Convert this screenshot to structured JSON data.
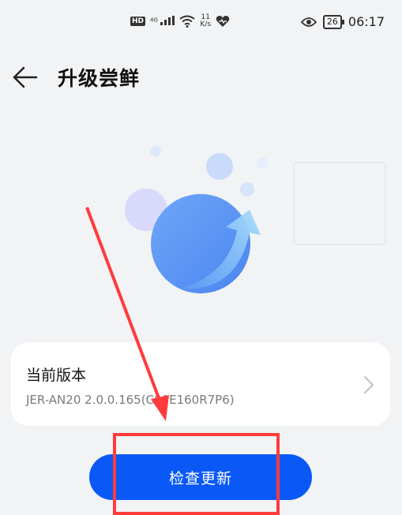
{
  "status_bar": {
    "hd": "HD",
    "network": "4G",
    "speed_value": "11",
    "speed_unit": "K/s",
    "battery": "26",
    "time": "06:17"
  },
  "header": {
    "title": "升级尝鲜",
    "back_icon": "arrow-left-icon"
  },
  "version": {
    "title": "当前版本",
    "value": "JER-AN20 2.0.0.165(C00E160R7P6)"
  },
  "check_button": {
    "label": "检查更新"
  },
  "colors": {
    "accent": "#0a59f7",
    "annotation": "#ff3b3b",
    "background": "#f1f3f5"
  }
}
